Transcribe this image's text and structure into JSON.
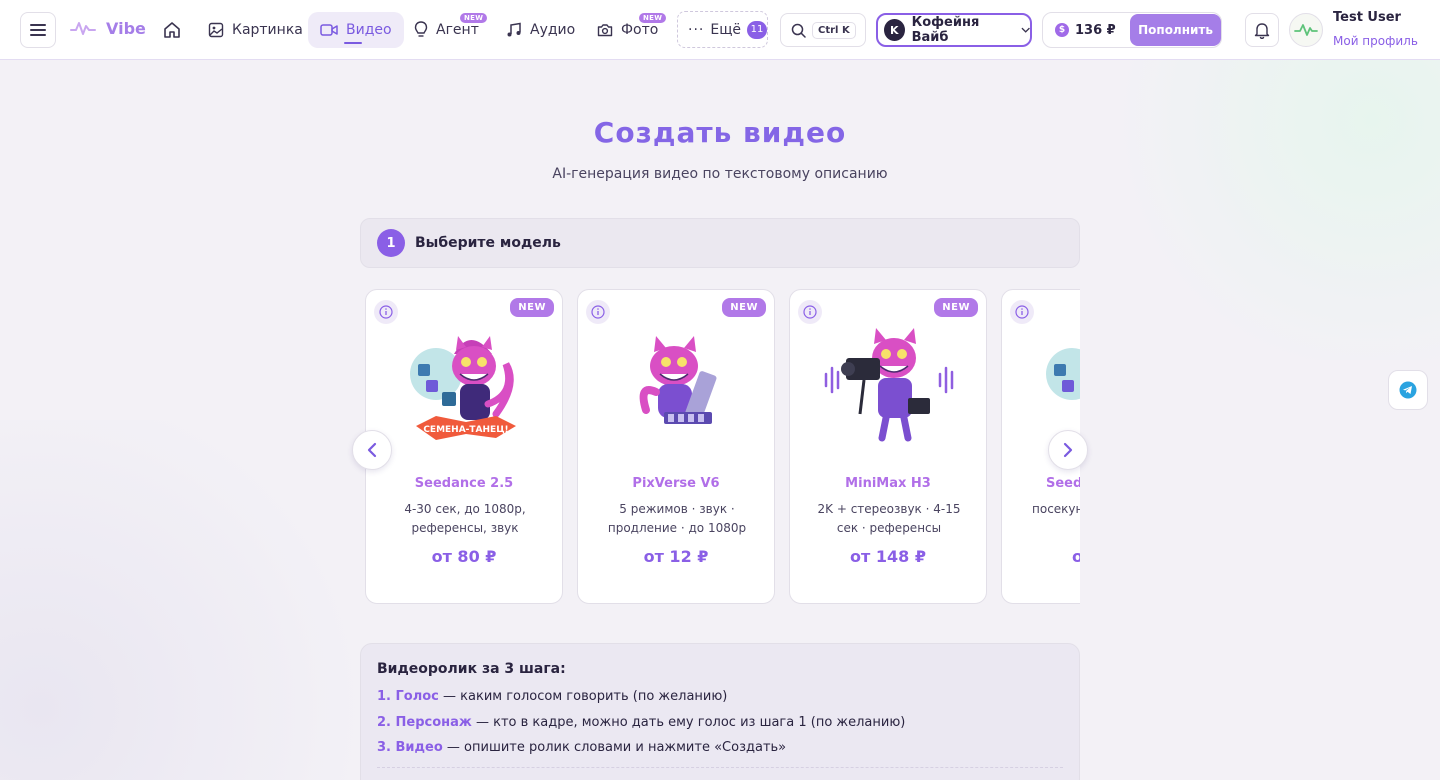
{
  "nav": {
    "logo_text": "Vibe",
    "items": [
      {
        "label": "Картинка",
        "badge": ""
      },
      {
        "label": "Видео",
        "badge": ""
      },
      {
        "label": "Агент",
        "badge": "NEW"
      },
      {
        "label": "Аудио",
        "badge": ""
      },
      {
        "label": "Фото",
        "badge": "NEW"
      }
    ],
    "more_label": "Ещё",
    "more_count": "11",
    "search_shortcut": "Ctrl K",
    "workspace_initial": "K",
    "workspace_name": "Кофейня Вайб",
    "balance": "136 ₽",
    "topup_label": "Пополнить",
    "user_name": "Test User",
    "profile_link": "Мой профиль"
  },
  "page": {
    "title": "Создать видео",
    "subtitle": "AI-генерация видео по текстовому описанию"
  },
  "step1": {
    "number": "1",
    "label": "Выберите модель"
  },
  "models": [
    {
      "name": "Seedance 2.5",
      "desc": "4-30 сек, до 1080p, референсы, звук",
      "price": "от 80 ₽",
      "badge": "NEW",
      "sign": "СЕМЕНА-ТАНЕЦ!"
    },
    {
      "name": "PixVerse V6",
      "desc": "5 режимов · звук · продление · до 1080p",
      "price": "от 12 ₽",
      "badge": "NEW",
      "sign": ""
    },
    {
      "name": "MiniMax H3",
      "desc": "2K + стереозвук · 4-15 сек · референсы",
      "price": "от 148 ₽",
      "badge": "NEW",
      "sign": ""
    },
    {
      "name": "Seed",
      "desc": "посекун рефер",
      "price": "о",
      "badge": "",
      "sign": ""
    }
  ],
  "howto": {
    "title": "Видеоролик за 3 шага:",
    "steps": [
      {
        "key": "1. Голос",
        "text": " — каким голосом говорить (по желанию)"
      },
      {
        "key": "2. Персонаж",
        "text": " — кто в кадре, можно дать ему голос из шага 1 (по желанию)"
      },
      {
        "key": "3. Видео",
        "text": " — опишите ролик словами и нажмите «Создать»"
      }
    ]
  },
  "colors": {
    "accent": "#8a5fe6",
    "model_name": "#b16fe8",
    "badge": "#b179e8"
  }
}
